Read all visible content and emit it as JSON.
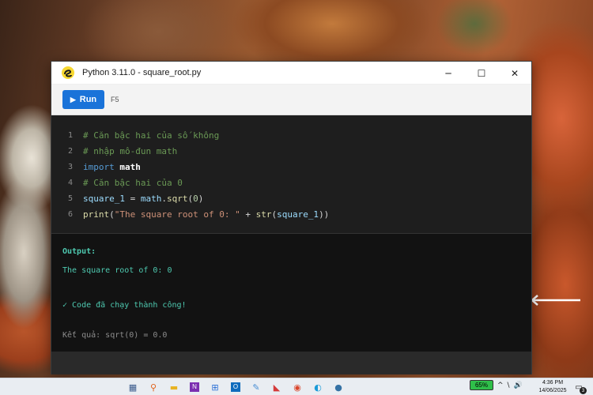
{
  "window": {
    "title": "Python 3.11.0 - square_root.py",
    "controls": {
      "minimize": "─",
      "maximize": "☐",
      "close": "✕"
    }
  },
  "toolbar": {
    "run_label": "Run",
    "run_icon": "▶",
    "shortcut": "F5"
  },
  "editor": {
    "lines": [
      {
        "num": "1",
        "text": "# Căn bậc hai của số không"
      },
      {
        "num": "2",
        "text": "# nhập mô-đun math"
      },
      {
        "num": "3",
        "kw": "import",
        "mod": "math"
      },
      {
        "num": "4",
        "text": "# Căn bậc hai của 0"
      },
      {
        "num": "5",
        "var": "square_1",
        "eq": " = ",
        "obj": "math",
        "dot": ".",
        "fn": "sqrt",
        "open": "(",
        "arg": "0",
        "close": ")"
      },
      {
        "num": "6",
        "fn": "print",
        "open": "(",
        "str": "\"The square root of 0: \"",
        "plus": " + ",
        "fn2": "str",
        "open2": "(",
        "arg": "square_1",
        "close": "))"
      }
    ]
  },
  "output": {
    "label": "Output:",
    "line": "The square root of 0: 0",
    "success": "✓ Code đã chạy thành công!",
    "result": "Kết quả: sqrt(0) = 0.0"
  },
  "taskbar": {
    "battery": "65%",
    "tray_glyphs": [
      "^",
      "\\",
      "🔊"
    ],
    "time": "4:36 PM",
    "date": "14/06/2025",
    "notification_count": "3",
    "icons": [
      "calculator-icon",
      "search-icon",
      "file-explorer-icon",
      "onenote-icon",
      "store-icon",
      "outlook-icon",
      "notepad-icon",
      "photos-icon",
      "chrome-icon",
      "edge-icon",
      "python-icon"
    ]
  }
}
